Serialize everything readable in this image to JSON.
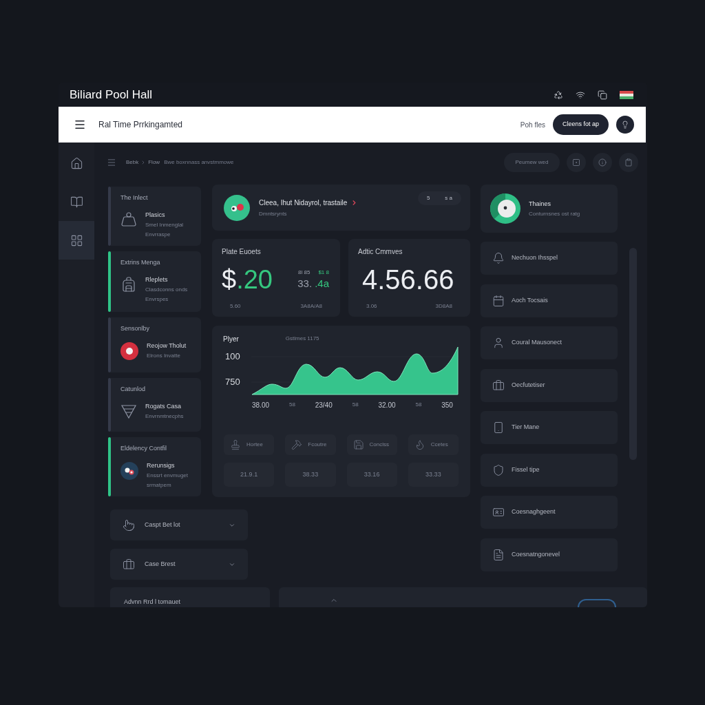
{
  "window": {
    "title": "Biliard Pool Hall"
  },
  "header": {
    "title": "Ral Time Prrkingamted",
    "link": "Poh fles",
    "button": "Cleens fot ap"
  },
  "rail": {
    "items": [
      {
        "selected": false
      },
      {
        "selected": false
      },
      {
        "selected": true
      }
    ]
  },
  "breadcrumb": {
    "items": [
      "Bebk",
      "Flow"
    ],
    "trail": "Bwe boxnnass anvstmmowe"
  },
  "toolbar": {
    "button": "Peumew wed"
  },
  "category_cards": [
    {
      "title": "The Inlect",
      "name": "Plasics",
      "lines": [
        "Smel Inmenglal",
        "Envrraspe"
      ],
      "active": false
    },
    {
      "title": "Extrins Menga",
      "name": "Rleplets",
      "lines": [
        "Clasdconns onds",
        "Envrspes"
      ],
      "active": true
    },
    {
      "title": "Sensonlby",
      "name": "Reojow Tholut",
      "lines": [
        "Elrons Invatte"
      ],
      "active": false
    },
    {
      "title": "Catunlod",
      "name": "Rogats Casa",
      "lines": [
        "Envrnmtnecphs"
      ],
      "active": false
    },
    {
      "title": "Eldelency Contfil",
      "name": "Rerunsigs",
      "lines": [
        "Enssrt envmuget",
        "srmatpem"
      ],
      "active": true
    }
  ],
  "alert_card": {
    "title": "Cleea, Ihut Nidayrol, trastaile",
    "subtitle": "Dmntsrynts",
    "badges": [
      "5",
      "s a"
    ]
  },
  "stat_cards": [
    {
      "title": "Plate Euoets",
      "value": [
        {
          "text": "$",
          "accent": false
        },
        {
          "text": ".20",
          "accent": true
        }
      ],
      "mini": [
        [
          {
            "text": "8l 85",
            "accent": false
          },
          {
            "text": "$1 8",
            "accent": true
          }
        ],
        [
          {
            "text": "33.",
            "accent": false
          },
          {
            "text": ".4a",
            "accent": true
          }
        ]
      ],
      "footer": [
        "5.60",
        "3A8A/A8"
      ]
    },
    {
      "title": "Adtic Cmmves",
      "value": [
        {
          "text": "4.56.66",
          "accent": false
        }
      ],
      "footer": [
        "3.06",
        "3D8A8"
      ]
    }
  ],
  "chart": {
    "title": "Plyer",
    "subtitle": "Gstlmes 1175",
    "y_labels": [
      "100",
      "750"
    ],
    "x_labels": [
      {
        "text": "38.00",
        "minor": false
      },
      {
        "text": "58",
        "minor": true
      },
      {
        "text": "23/40",
        "minor": false
      },
      {
        "text": "58",
        "minor": true
      },
      {
        "text": "32.00",
        "minor": false
      },
      {
        "text": "58",
        "minor": true
      },
      {
        "text": "350",
        "minor": false
      }
    ]
  },
  "tiles": [
    {
      "label": "Hortee",
      "value": "21.9.1"
    },
    {
      "label": "Fcoutre",
      "value": "38.33"
    },
    {
      "label": "Conclss",
      "value": "33.16"
    },
    {
      "label": "Ccetes",
      "value": "33.33"
    }
  ],
  "accordions": [
    {
      "label": "Caspt Bet lot",
      "expanded": false
    },
    {
      "label": "Case Brest",
      "expanded": false
    }
  ],
  "profile_card": {
    "name": "Thaines",
    "subtitle": "Conturnsnes ost ratg"
  },
  "menu_items": [
    "Nechuon Ihsspel",
    "Aoch Tocsais",
    "Coural Mausonect",
    "Oecfutetiser",
    "Tier Mane",
    "Fissel tipe",
    "Coesnaghgeent",
    "Coesnatngonevel"
  ],
  "footer": {
    "panel_title": "Advnn Rrd l tomauet"
  }
}
